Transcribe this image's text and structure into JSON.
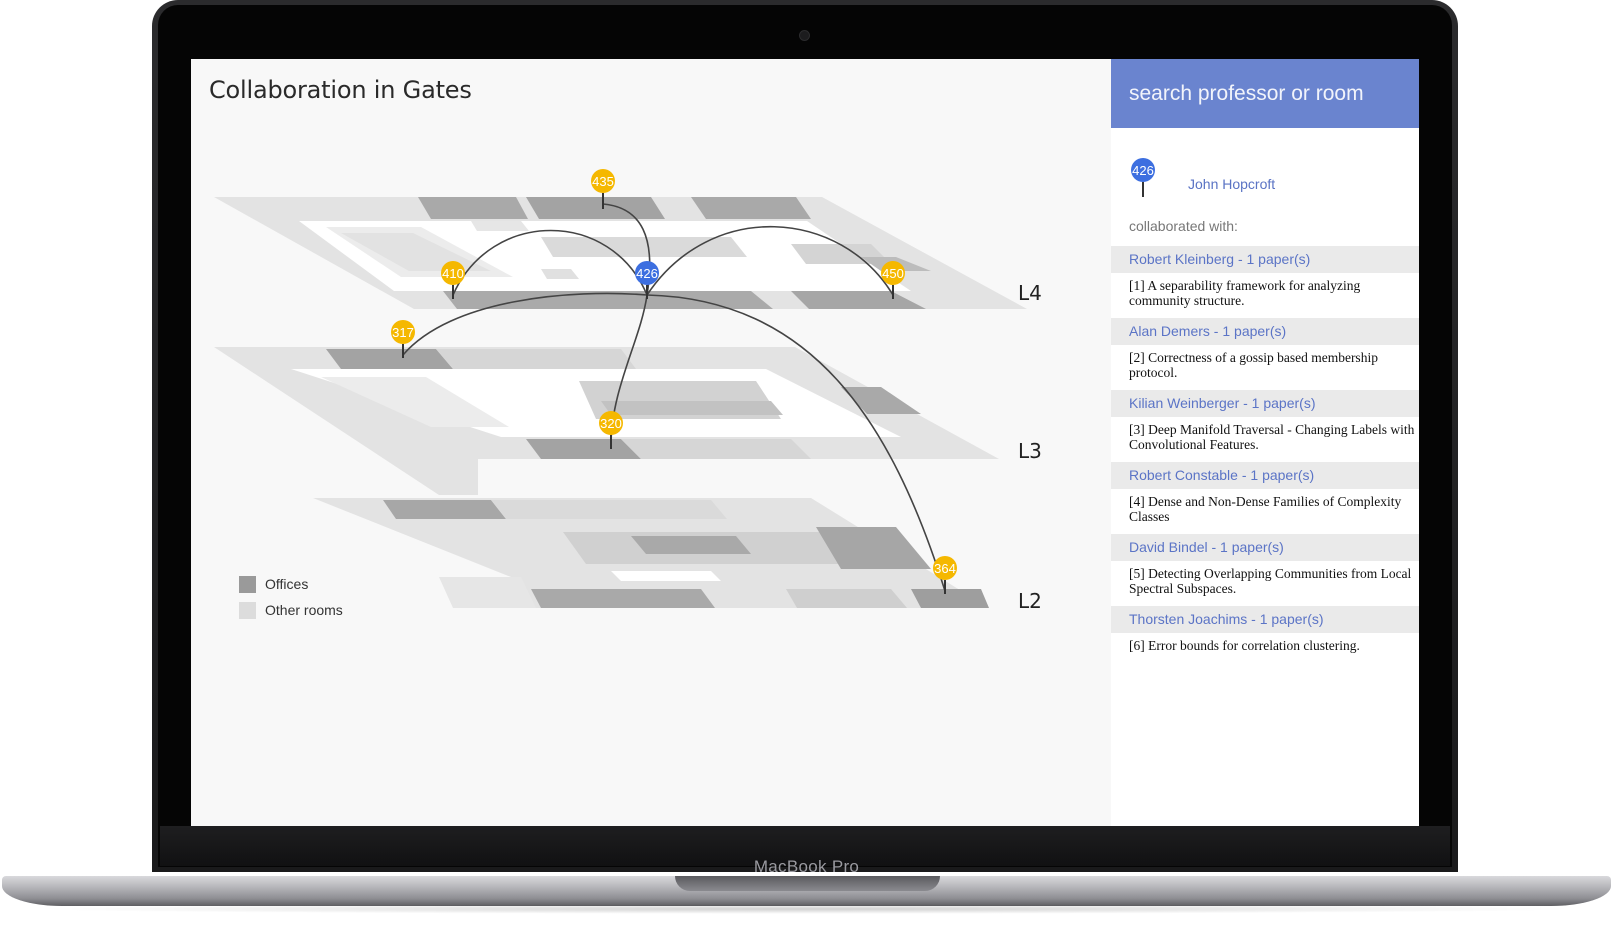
{
  "app": {
    "title": "Collaboration in Gates"
  },
  "device": {
    "brand": "MacBook Pro"
  },
  "search": {
    "placeholder": "search professor or room"
  },
  "selected": {
    "room": "426",
    "name": "John Hopcroft"
  },
  "collaborated_label": "collaborated with:",
  "collaborators": [
    {
      "name": "Robert Kleinberg - 1 paper(s)",
      "paper": "[1] A separability framework for analyzing community structure."
    },
    {
      "name": "Alan Demers - 1 paper(s)",
      "paper": "[2] Correctness of a gossip based membership protocol."
    },
    {
      "name": "Kilian Weinberger - 1 paper(s)",
      "paper": "[3] Deep Manifold Traversal - Changing Labels with Convolutional Features."
    },
    {
      "name": "Robert Constable - 1 paper(s)",
      "paper": "[4] Dense and Non-Dense Families of Complexity Classes"
    },
    {
      "name": "David Bindel - 1 paper(s)",
      "paper": "[5] Detecting Overlapping Communities from Local Spectral Subspaces."
    },
    {
      "name": "Thorsten Joachims - 1 paper(s)",
      "paper": "[6] Error bounds for correlation clustering."
    }
  ],
  "legend": {
    "offices": "Offices",
    "other_rooms": "Other rooms"
  },
  "floors": {
    "l4": "L4",
    "l3": "L3",
    "l2": "L2"
  },
  "pins": {
    "p435": "435",
    "p410": "410",
    "p426": "426",
    "p450": "450",
    "p317": "317",
    "p320": "320",
    "p364": "364"
  },
  "colors": {
    "accent": "#6a84cf",
    "selected_pin": "#3d6fe0",
    "pin": "#f5b800",
    "office": "#9a9a9a",
    "other_room": "#dcdcdc"
  }
}
